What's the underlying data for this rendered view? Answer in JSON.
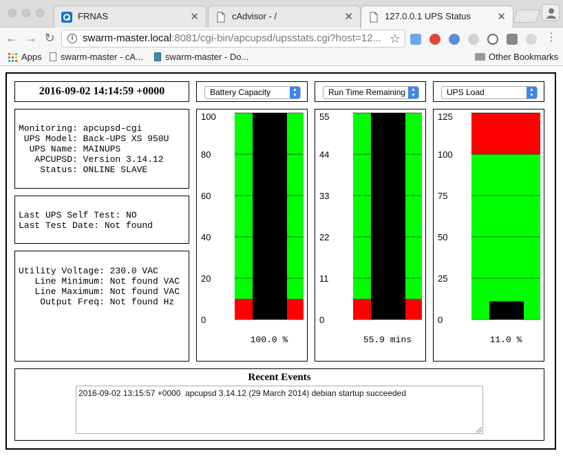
{
  "browser": {
    "tabs": [
      {
        "title": "FRNAS",
        "icon": "frnas-app-icon"
      },
      {
        "title": "cAdvisor - /",
        "icon": "document-icon"
      },
      {
        "title": "127.0.0.1 UPS Status",
        "icon": "document-icon"
      }
    ],
    "url_host": "swarm-master.local",
    "url_rest": ":8081/cgi-bin/apcupsd/upsstats.cgi?host=12...",
    "bookmarks": {
      "apps": "Apps",
      "items": [
        "swarm-master - cA...",
        "swarm-master - Do..."
      ],
      "other": "Other Bookmarks"
    }
  },
  "status": {
    "datetime": "2016-09-02 14:14:59 +0000",
    "info_lines": [
      "Monitoring: apcupsd-cgi",
      " UPS Model: Back-UPS XS 950U",
      "  UPS Name: MAINUPS",
      "   APCUPSD: Version 3.14.12",
      "    Status: ONLINE SLAVE"
    ],
    "selftest_lines": [
      "Last UPS Self Test: NO",
      "Last Test Date: Not found"
    ],
    "voltage_lines": [
      "Utility Voltage: 230.0 VAC",
      "   Line Minimum: Not found VAC",
      "   Line Maximum: Not found VAC",
      "    Output Freq: Not found Hz"
    ]
  },
  "selects": [
    "Battery Capacity",
    "Run Time Remaining",
    "UPS Load"
  ],
  "colors": {
    "green": "#00ff00",
    "red": "#ff0000",
    "bar": "#000000",
    "select_arrow": "#3b86f0"
  },
  "chart_data": [
    {
      "type": "bar",
      "title": "Battery Capacity",
      "ticks": [
        0,
        20,
        40,
        60,
        80,
        100
      ],
      "ylim": [
        0,
        100
      ],
      "value": 100.0,
      "value_label": "100.0 %",
      "bands": [
        {
          "from": 0,
          "to": 10,
          "color": "#ff0000"
        },
        {
          "from": 10,
          "to": 100,
          "color": "#00ff00"
        }
      ]
    },
    {
      "type": "bar",
      "title": "Run Time Remaining",
      "ticks": [
        0,
        11,
        22,
        33,
        44,
        55
      ],
      "ylim": [
        0,
        55
      ],
      "value": 55.9,
      "value_label": "55.9 mins",
      "bands": [
        {
          "from": 0,
          "to": 5.5,
          "color": "#ff0000"
        },
        {
          "from": 5.5,
          "to": 55,
          "color": "#00ff00"
        }
      ]
    },
    {
      "type": "bar",
      "title": "UPS Load",
      "ticks": [
        0,
        25,
        50,
        75,
        100,
        125
      ],
      "ylim": [
        0,
        125
      ],
      "value": 11.0,
      "value_label": "11.0 %",
      "bands": [
        {
          "from": 0,
          "to": 100,
          "color": "#00ff00"
        },
        {
          "from": 100,
          "to": 125,
          "color": "#ff0000"
        }
      ]
    }
  ],
  "events": {
    "title": "Recent Events",
    "text": "2016-09-02 13:15:57 +0000  apcupsd 3.14.12 (29 March 2014) debian startup succeeded"
  }
}
